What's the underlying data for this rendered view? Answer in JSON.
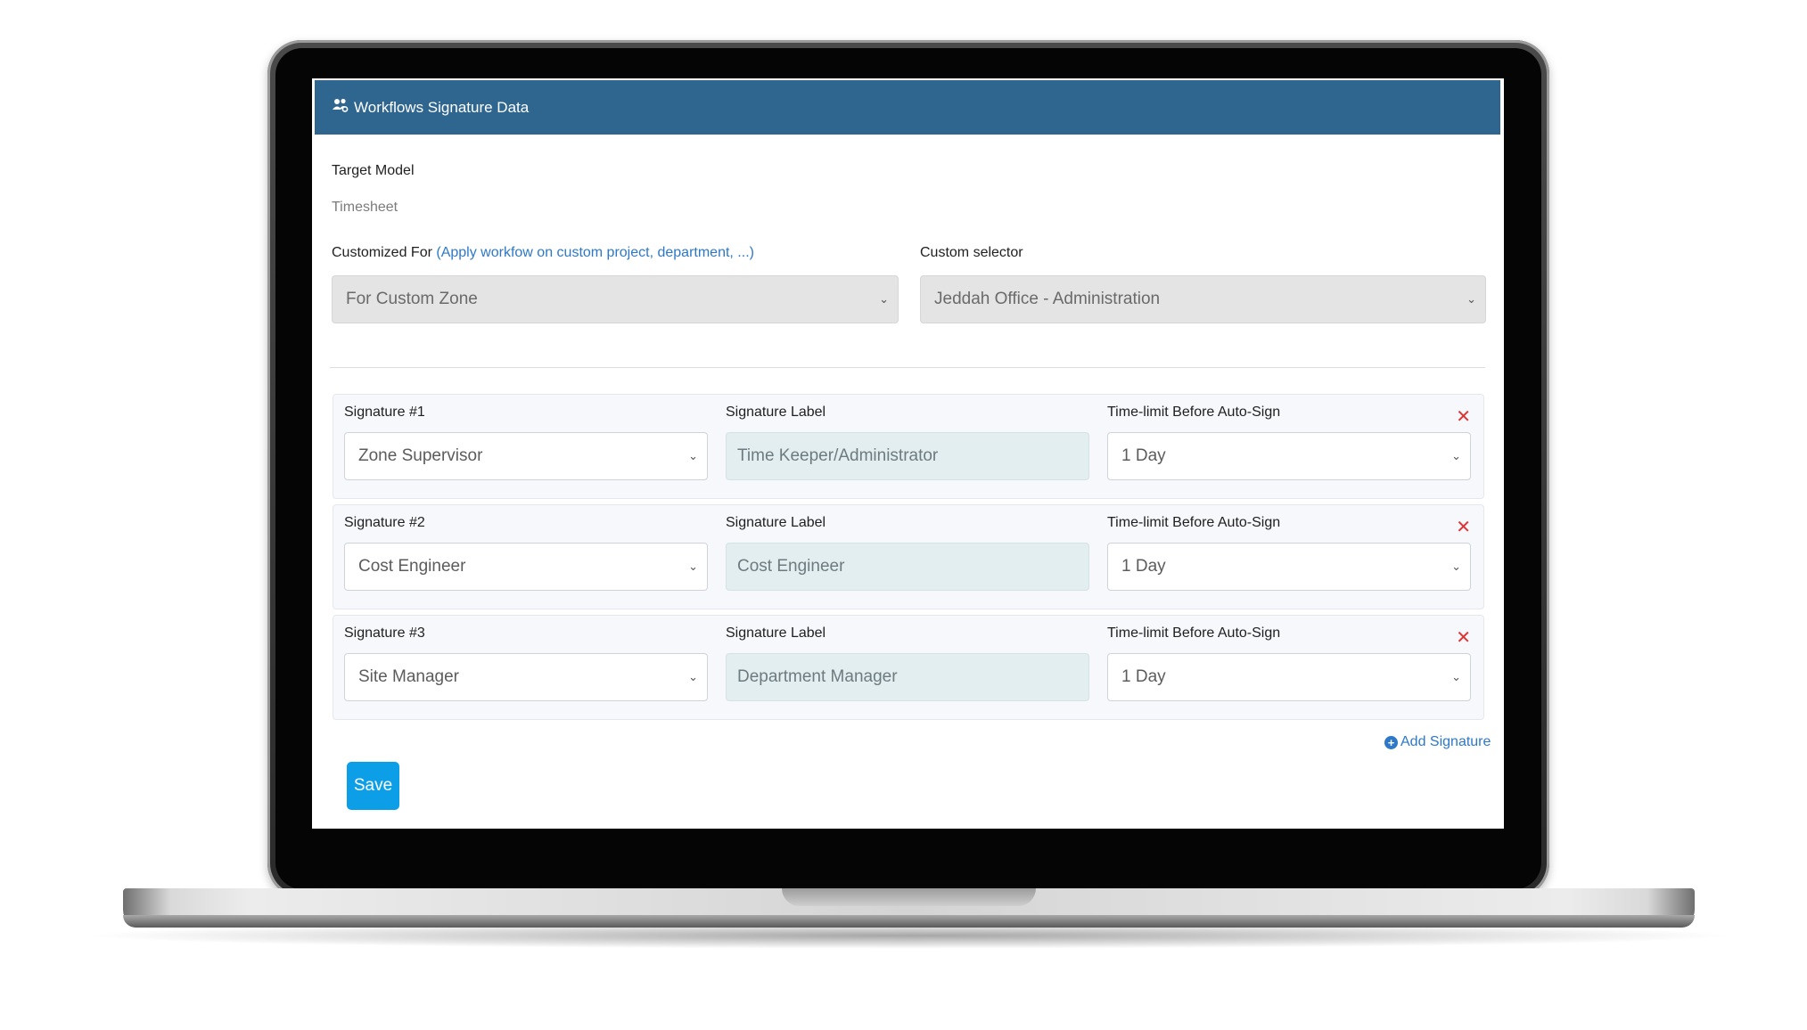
{
  "header": {
    "title": "Workflows Signature Data",
    "icon": "users-gear-icon"
  },
  "target_model": {
    "label": "Target Model",
    "value": "Timesheet"
  },
  "customized_for": {
    "label": "Customized For",
    "hint": "(Apply workfow on custom project, department, ...)",
    "value": "For Custom Zone"
  },
  "custom_selector": {
    "label": "Custom selector",
    "value": "Jeddah Office - Administration"
  },
  "signatures": [
    {
      "label": "Signature #1",
      "value": "Zone Supervisor",
      "sig_label_title": "Signature Label",
      "sig_label_value": "Time Keeper/Administrator",
      "time_title": "Time-limit Before Auto-Sign",
      "time_value": "1 Day"
    },
    {
      "label": "Signature #2",
      "value": "Cost Engineer",
      "sig_label_title": "Signature Label",
      "sig_label_value": "Cost Engineer",
      "time_title": "Time-limit Before Auto-Sign",
      "time_value": "1 Day"
    },
    {
      "label": "Signature #3",
      "value": "Site Manager",
      "sig_label_title": "Signature Label",
      "sig_label_value": "Department Manager",
      "time_title": "Time-limit Before Auto-Sign",
      "time_value": "1 Day"
    }
  ],
  "remove_glyph": "✕",
  "add_signature": "Add Signature",
  "save": "Save",
  "colors": {
    "header": "#2e6690",
    "accent": "#2d79c7",
    "save": "#0d9ee8",
    "remove": "#e03232"
  }
}
